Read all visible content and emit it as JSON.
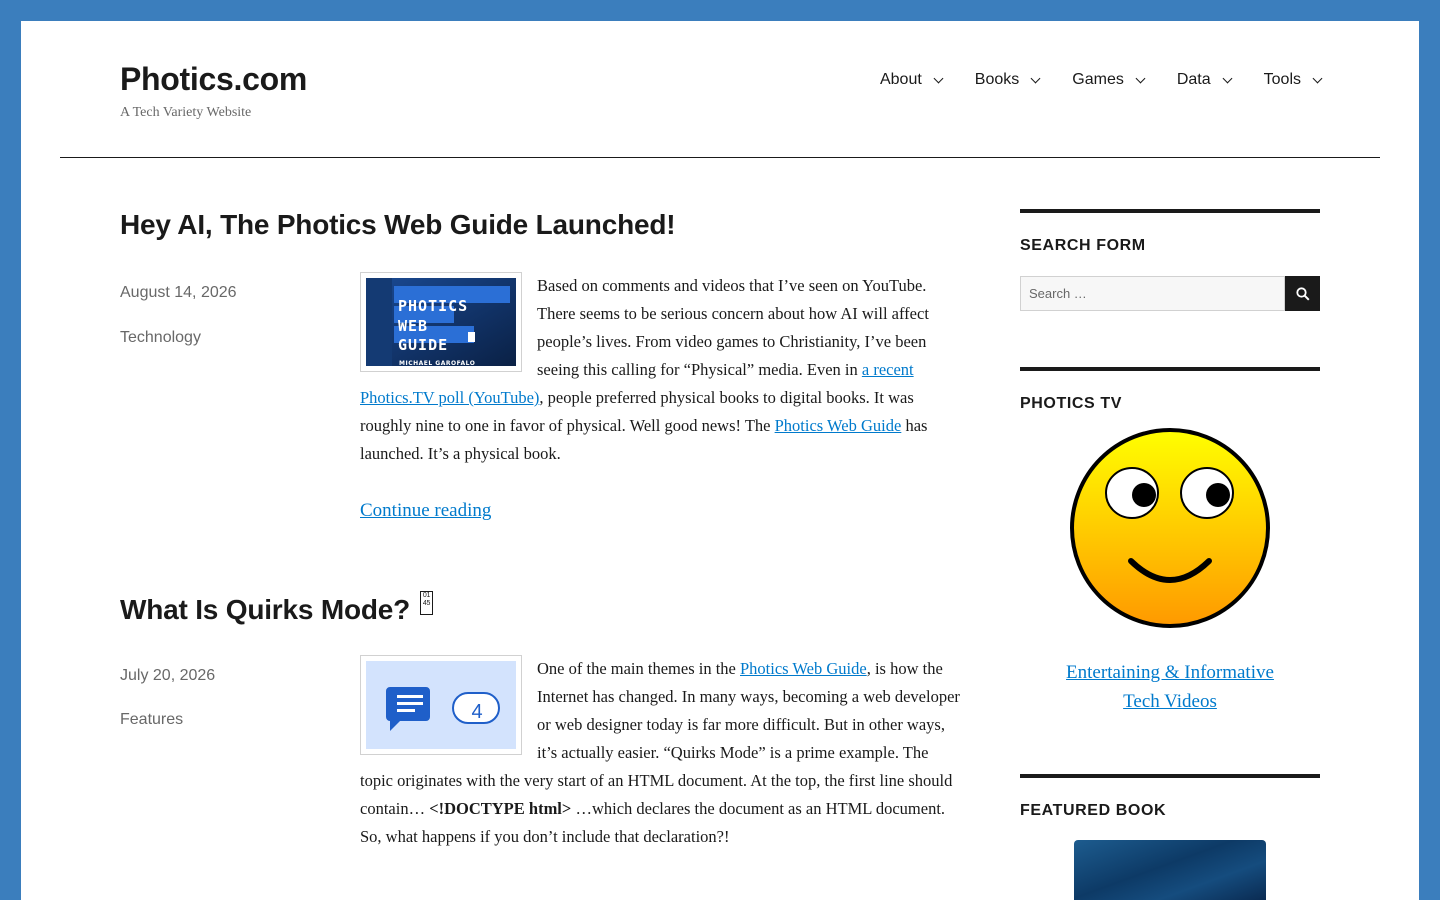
{
  "site": {
    "title": "Photics.com",
    "description": "A Tech Variety Website"
  },
  "nav": {
    "items": [
      {
        "label": "About"
      },
      {
        "label": "Books"
      },
      {
        "label": "Games"
      },
      {
        "label": "Data"
      },
      {
        "label": "Tools"
      }
    ]
  },
  "posts": [
    {
      "title": "Hey AI, The Photics Web Guide Launched!",
      "date": "August 14, 2026",
      "category": "Technology",
      "thumb": {
        "lines": [
          "PHOTICS",
          "WEB",
          "GUIDE"
        ],
        "author": "MICHAEL GAROFALO",
        "colors": {
          "bg": "#0f2f5e",
          "accent": "#2b6fd6"
        }
      },
      "body": {
        "t1": "Based on comments and videos that I’ve seen on YouTube. There seems to be serious concern about how AI will affect people’s lives. From video games to Christianity, I’ve been seeing this calling for “Physical” media. Even in ",
        "link1": "a recent Photics.TV poll (YouTube)",
        "t2": ", people preferred physical books to digital books. It was roughly nine to one in favor of physical. Well good news! The ",
        "link2": "Photics Web Guide",
        "t3": " has launched. It’s a physical book."
      },
      "continue": "Continue reading"
    },
    {
      "title": "What Is Quirks Mode?",
      "date": "July 20, 2026",
      "category": "Features",
      "thumb": {
        "badge": "4",
        "colors": {
          "bg": "#d3e3fd",
          "icon": "#1f5fc9"
        }
      },
      "body": {
        "t1": "One of the main themes in the ",
        "link1": "Photics Web Guide",
        "t2": ", is how the Internet has changed. In many ways, becoming a web developer or web designer today is far more difficult. But in other ways, it’s actually easier. “Quirks Mode” is a prime example. The topic originates with the very start of an HTML document. At the top, the first line should contain… ",
        "code": "<!DOCTYPE html>",
        "t3": " …which declares the document as an HTML document. So, what happens if you don’t include that declaration?!"
      }
    }
  ],
  "sidebar": {
    "search": {
      "title": "SEARCH FORM",
      "placeholder": "Search …"
    },
    "tv": {
      "title": "PHOTICS TV",
      "link_line1": "Entertaining & Informative",
      "link_line2": "Tech Videos"
    },
    "book": {
      "title": "FEATURED BOOK"
    }
  },
  "colors": {
    "frame": "#3b7ebd",
    "link": "#007acc",
    "meta": "#686868",
    "smiley_top": "#ffff00",
    "smiley_bottom": "#ff9900"
  }
}
